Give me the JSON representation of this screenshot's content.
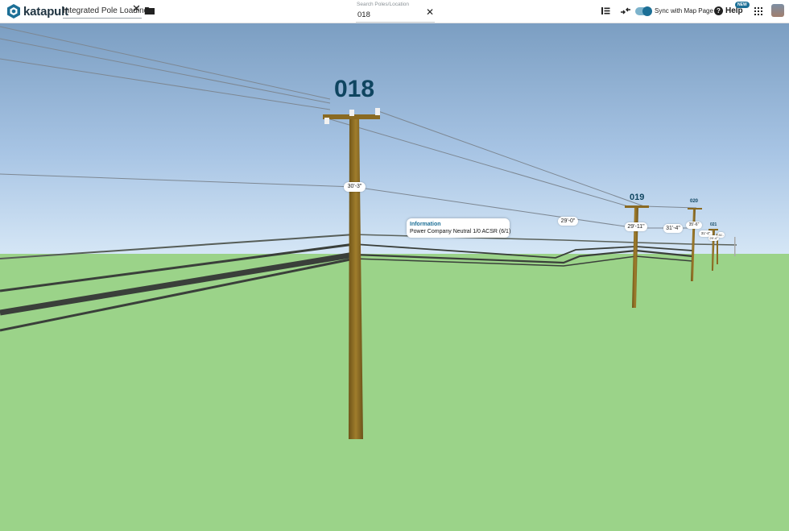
{
  "app": {
    "brand": "katapult",
    "brand_color": "#1f3340",
    "accent": "#1c6f96"
  },
  "header": {
    "job_name": "Integrated Pole Loading",
    "search": {
      "label": "Search Poles/Location",
      "value": "018"
    },
    "sync_label": "Sync with Map Page",
    "sync_enabled": true,
    "help_label": "Help",
    "new_badge": "NEW"
  },
  "icons": [
    "katapult-logo-icon",
    "close-icon",
    "folder-icon",
    "list-sort-icon",
    "collapse-arrows-icon",
    "help-circle-icon",
    "apps-grid-icon"
  ],
  "scene": {
    "poles": [
      "018",
      "019",
      "020",
      "021"
    ],
    "height_tags": [
      "30'-3\"",
      "29'-0\"",
      "29'-11\"",
      "31'-4\"",
      "35'-6\"",
      "31'-4\"",
      "29'-4\"",
      "31'-"
    ],
    "info_popup": {
      "title": "Information",
      "detail": "Power Company Neutral 1/0 ACSR (6/1)"
    }
  }
}
